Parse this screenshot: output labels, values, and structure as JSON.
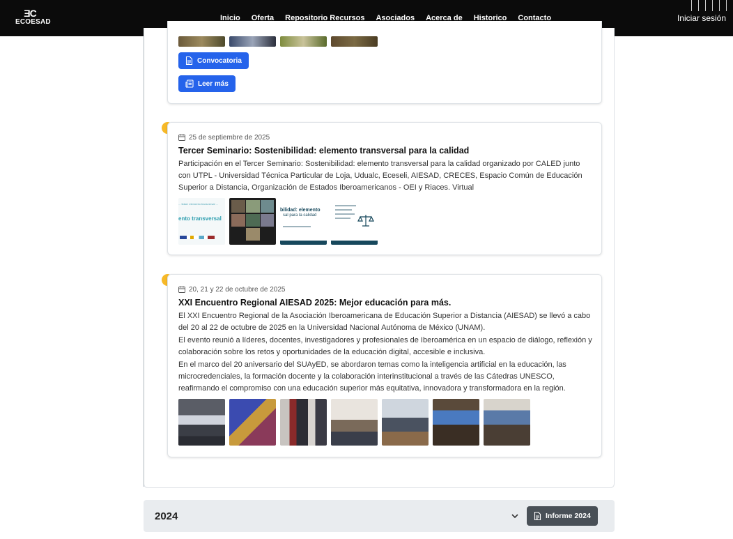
{
  "brand": {
    "mark": "ƎC",
    "name": "ECOESAD"
  },
  "nav": {
    "links": [
      {
        "label": "Inicio"
      },
      {
        "label": "Oferta"
      },
      {
        "label": "Repositorio Recursos"
      },
      {
        "label": "Asociados"
      },
      {
        "label": "Acerca de"
      },
      {
        "label": "Historico",
        "active": true
      },
      {
        "label": "Contacto"
      }
    ],
    "login": "Iniciar sesión"
  },
  "events": [
    {
      "buttons": {
        "convocatoria": "Convocatoria",
        "leer_mas": "Leer más"
      },
      "thumb_icons": [
        "photo-thumbnail",
        "photo-thumbnail",
        "photo-thumbnail",
        "photo-thumbnail"
      ]
    },
    {
      "date": "25 de septiembre de 2025",
      "title": "Tercer Seminario: Sostenibilidad: elemento transversal para la calidad",
      "description": "Participación en el Tercer Seminario: Sostenibilidad: elemento transversal para la calidad organizado por CALED junto con UTPL - Universidad Técnica Particular de Loja, Udualc, Eceseli, AIESAD, CRECES, Espacio Común de Educación Superior a Distancia, Organización de Estados Iberoamericanos - OEI y Riaces. Virtual",
      "thumb_texts": {
        "t1_top": "... tidad: elemento transversal ...",
        "t1_main": "ento transversal",
        "t3_main": "bilidad: elemento",
        "t3_sub": "sal para la calidad"
      }
    },
    {
      "date": "20, 21 y 22 de octubre de 2025",
      "title": "XXI Encuentro Regional AIESAD 2025: Mejor educación para más.",
      "paragraphs": [
        "El XXI Encuentro Regional de la Asociación Iberoamericana de Educación Superior a Distancia (AIESAD) se llevó a cabo del 20 al 22 de octubre de 2025 en la Universidad Nacional Autónoma de México (UNAM).",
        "El evento reunió a líderes, docentes, investigadores y profesionales de Iberoamérica en un espacio de diálogo, reflexión y colaboración sobre los retos y oportunidades de la educación digital, accesible e inclusiva.",
        "En el marco del 20 aniversario del SUAyED, se abordaron temas como la inteligencia artificial en la educación, las microcredenciales, la formación docente y la colaboración interinstitucional a través de las Cátedras UNESCO, reafirmando el compromiso con una educación superior más equitativa, innovadora y transformadora en la región."
      ],
      "photo_count": 7
    }
  ],
  "accordion": {
    "year": "2024",
    "report_button": "Informe 2024"
  },
  "colors": {
    "navbar": "#0b0b0b",
    "accent_blue": "#2563eb",
    "timeline_dot": "#f7b928",
    "report_button": "#495057"
  }
}
